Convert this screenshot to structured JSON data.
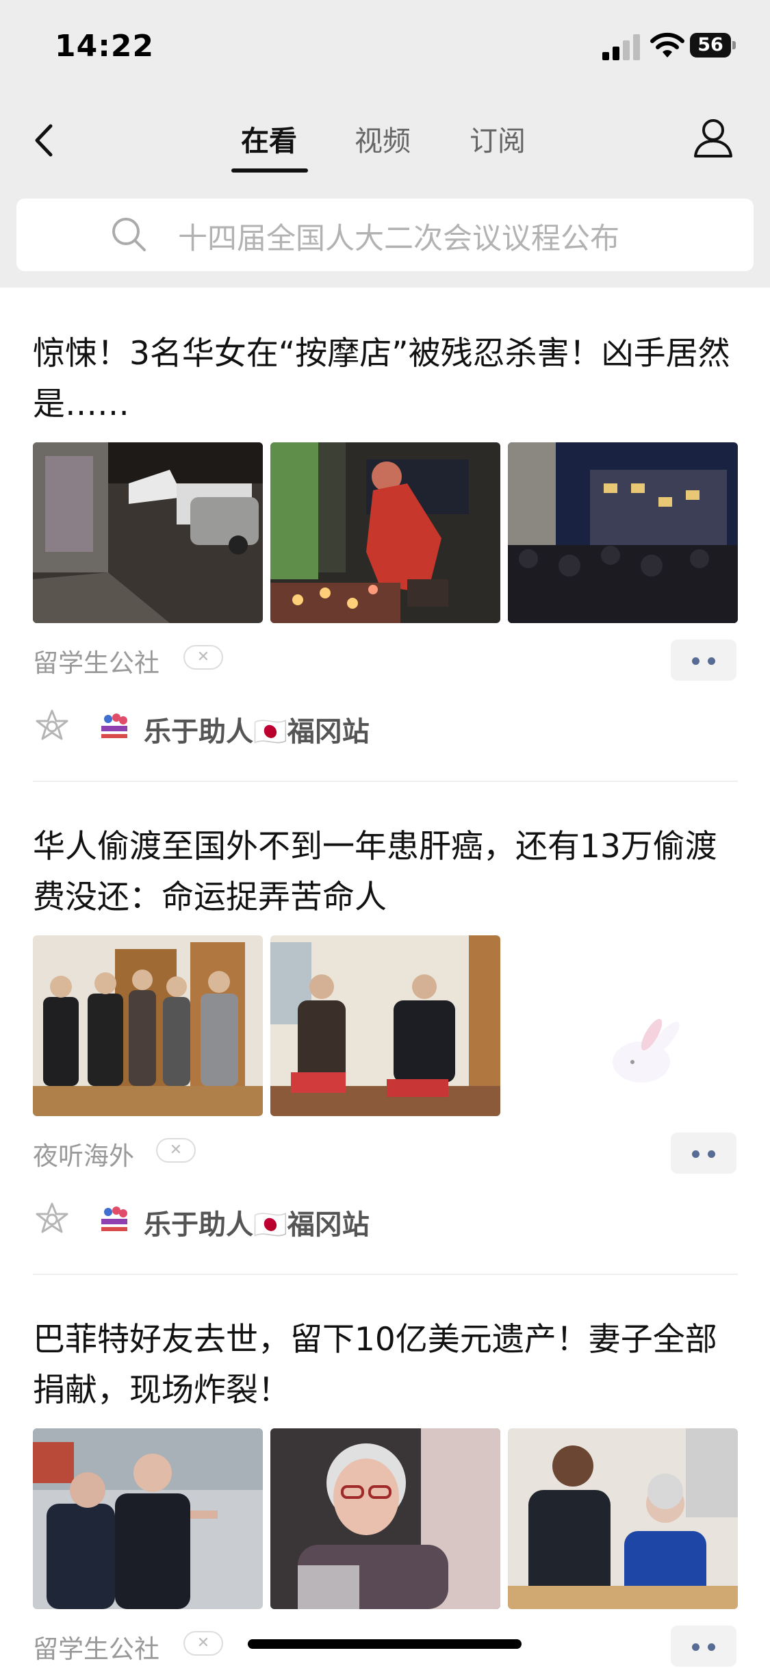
{
  "status_bar": {
    "time": "14:22",
    "battery": "56"
  },
  "nav": {
    "tabs": [
      {
        "label": "在看",
        "active": true
      },
      {
        "label": "视频",
        "active": false
      },
      {
        "label": "订阅",
        "active": false
      }
    ]
  },
  "search": {
    "placeholder": "十四届全国人大二次会议议程公布"
  },
  "articles": [
    {
      "title": "惊悚！3名华女在“按摩店”被残忍杀害！凶手居然是……",
      "source": "留学生公社",
      "friend": "乐于助人🇯🇵福冈站",
      "images": [
        "rainy-street-police-tent-photo",
        "woman-lighting-candles-memorial-photo",
        "night-crowd-vigil-photo"
      ]
    },
    {
      "title": "华人偷渡至国外不到一年患肝癌，还有13万偷渡费没还：命运捉弄苦命人",
      "source": "夜听海外",
      "friend": "乐于助人🇯🇵福冈站",
      "images": [
        "group-of-men-indoors-photo",
        "two-men-sitting-talking-photo",
        "bunny-sleeping-on-moon-illustration"
      ]
    },
    {
      "title": "巴菲特好友去世，留下10亿美元遗产！妻子全部捐献，现场炸裂！",
      "source": "留学生公社",
      "images": [
        "two-elderly-men-suits-photo",
        "elderly-woman-glasses-photo",
        "man-and-elderly-woman-seated-photo"
      ]
    }
  ],
  "icons": {
    "back": "chevron-left-icon",
    "profile": "person-icon",
    "search": "search-icon",
    "dismiss": "close-icon",
    "more": "more-dots-icon",
    "friend_star": "star-outline-icon"
  },
  "colors": {
    "accent": "#576b95",
    "topbar_bg": "#ededed"
  }
}
